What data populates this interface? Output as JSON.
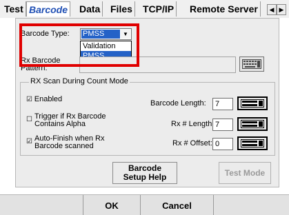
{
  "tabs": [
    {
      "label": "Test"
    },
    {
      "label": "Barcode"
    },
    {
      "label": "Data"
    },
    {
      "label": "Files"
    },
    {
      "label": "TCP/IP"
    },
    {
      "label": "Remote Server"
    }
  ],
  "tab_arrows": {
    "left": "◀",
    "right": "▶"
  },
  "barcode": {
    "type_label": "Barcode Type:",
    "type_value": "PMSS",
    "dropdown_options": [
      "Validation",
      "PMSS"
    ],
    "pattern_label": "Rx Barcode Pattern:",
    "pattern_value": ""
  },
  "scan_group": {
    "title": "RX Scan During Count Mode",
    "enabled_label": "Enabled",
    "enabled_checked": true,
    "trigger_label": "Trigger if Rx Barcode Contains Alpha",
    "trigger_checked": false,
    "autofinish_label": "Auto-Finish when Rx Barcode scanned",
    "autofinish_checked": true,
    "barcode_length_label": "Barcode Length:",
    "barcode_length_value": "7",
    "rx_length_label": "Rx # Length:",
    "rx_length_value": "7",
    "rx_offset_label": "Rx # Offset:",
    "rx_offset_value": "0"
  },
  "buttons": {
    "setup_help": "Barcode Setup Help",
    "test_mode": "Test Mode"
  },
  "bottom": {
    "ok": "OK",
    "cancel": "Cancel"
  },
  "colors": {
    "active_tab": "#1f4fb4",
    "selection": "#2462c7",
    "highlight_box": "#e00000"
  }
}
